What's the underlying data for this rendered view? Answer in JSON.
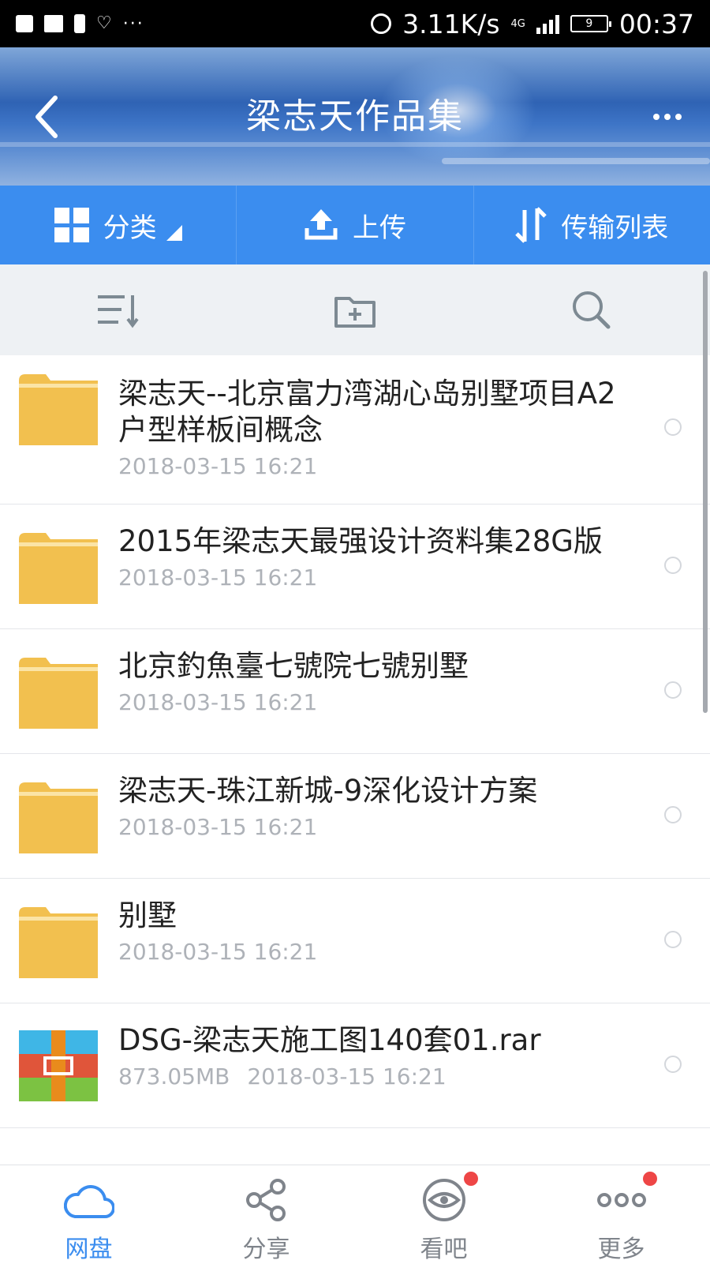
{
  "status_bar": {
    "net_speed": "3.11K/s",
    "network_type": "4G",
    "battery_level": "9",
    "time": "00:37"
  },
  "header": {
    "title": "梁志天作品集"
  },
  "action_bar": {
    "category_label": "分类",
    "upload_label": "上传",
    "transfer_label": "传输列表"
  },
  "files": [
    {
      "name": "梁志天--北京富力湾湖心岛别墅项目A2户型样板间概念",
      "date": "2018-03-15  16:21",
      "size": "",
      "type": "folder"
    },
    {
      "name": "2015年梁志天最强设计资料集28G版",
      "date": "2018-03-15  16:21",
      "size": "",
      "type": "folder"
    },
    {
      "name": "北京釣魚臺七號院七號别墅",
      "date": "2018-03-15  16:21",
      "size": "",
      "type": "folder"
    },
    {
      "name": "梁志天-珠江新城-9深化设计方案",
      "date": "2018-03-15  16:21",
      "size": "",
      "type": "folder"
    },
    {
      "name": "别墅",
      "date": "2018-03-15  16:21",
      "size": "",
      "type": "folder"
    },
    {
      "name": "DSG-梁志天施工图140套01.rar",
      "date": "2018-03-15  16:21",
      "size": "873.05MB",
      "type": "archive"
    }
  ],
  "bottom_nav": {
    "items": [
      {
        "label": "网盘",
        "icon": "cloud-icon",
        "active": true,
        "badge": false
      },
      {
        "label": "分享",
        "icon": "share-icon",
        "active": false,
        "badge": false
      },
      {
        "label": "看吧",
        "icon": "eye-icon",
        "active": false,
        "badge": true
      },
      {
        "label": "更多",
        "icon": "more-dots-icon",
        "active": false,
        "badge": true
      }
    ]
  },
  "colors": {
    "accent": "#3b8def",
    "folder": "#f2c04f",
    "badge": "#ee4646"
  }
}
